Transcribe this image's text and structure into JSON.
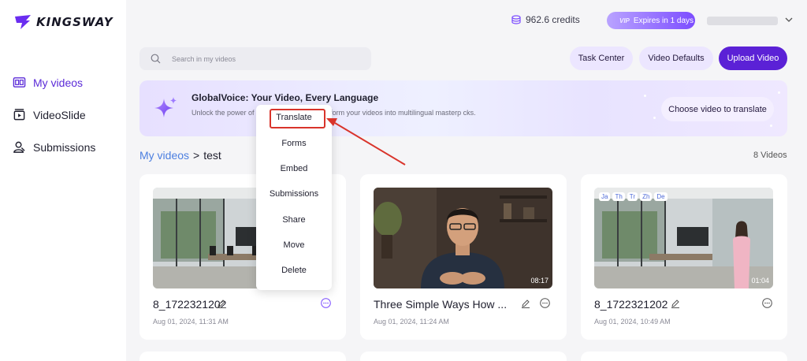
{
  "brand": {
    "name": "KINGSWAY"
  },
  "sidebar": {
    "items": [
      {
        "label": "My videos",
        "icon": "film-icon",
        "active": true
      },
      {
        "label": "VideoSlide",
        "icon": "slides-icon",
        "active": false
      },
      {
        "label": "Submissions",
        "icon": "user-icon",
        "active": false
      }
    ]
  },
  "header": {
    "credits": "962.6 credits",
    "vip_badge": "VIP",
    "vip_text": "Expires in 1 days"
  },
  "search": {
    "placeholder": "Search in my videos"
  },
  "toolbar": {
    "task_center": "Task Center",
    "video_defaults": "Video Defaults",
    "upload_video": "Upload Video"
  },
  "banner": {
    "title": "GlobalVoice: Your Video, Every Language",
    "description": "Unlock the power of with GlobalVoice. Transform your videos into multilingual masterp cks.",
    "button": "Choose video to translate"
  },
  "breadcrumb": {
    "root": "My videos",
    "separator": ">",
    "current": "test"
  },
  "video_count": "8 Videos",
  "videos": [
    {
      "title": "8_1722321202",
      "date": "Aug 01, 2024, 11:31 AM",
      "duration": ""
    },
    {
      "title": "Three Simple Ways How ...",
      "date": "Aug 01, 2024, 11:24 AM",
      "duration": "08:17"
    },
    {
      "title": "8_1722321202",
      "date": "Aug 01, 2024, 10:49 AM",
      "duration": "01:04",
      "lang_tags": [
        "Ja",
        "Th",
        "Tr",
        "Zh",
        "De"
      ]
    }
  ],
  "context_menu": {
    "items": [
      "Translate",
      "Forms",
      "Embed",
      "Submissions",
      "Share",
      "Move",
      "Delete"
    ],
    "highlighted": "Translate"
  },
  "colors": {
    "accent": "#5b21d6",
    "link": "#4c7fe0",
    "highlight": "#d9342b"
  }
}
